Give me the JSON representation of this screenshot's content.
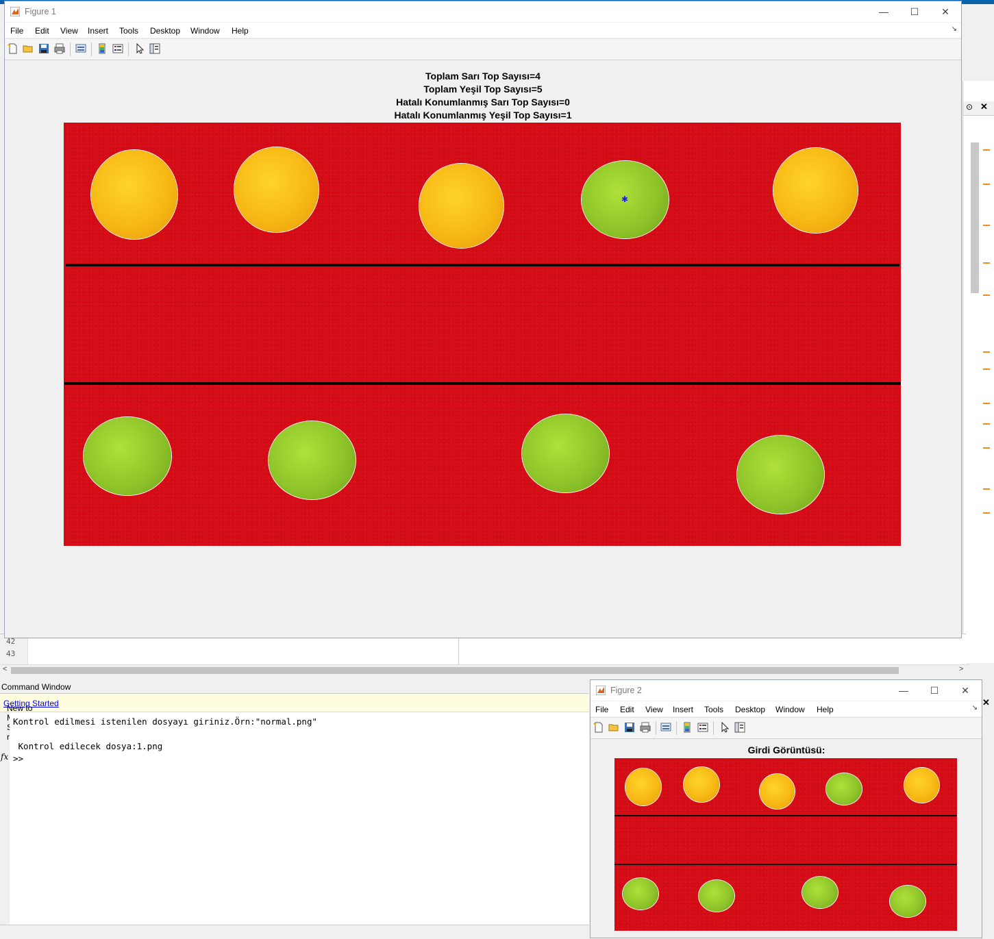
{
  "figure1": {
    "window_title": "Figure 1",
    "menu": [
      "File",
      "Edit",
      "View",
      "Insert",
      "Tools",
      "Desktop",
      "Window",
      "Help"
    ],
    "title_lines": [
      "Toplam Sarı Top Sayısı=4",
      "Toplam Yeşil Top Sayısı=5",
      "Hatalı Konumlanmış Sarı Top Sayısı=0",
      "Hatalı Konumlanmış Yeşil Top Sayısı=1"
    ],
    "ball_colors": {
      "yellow": "#f7b814",
      "green": "#8fc52a"
    },
    "court_color": "#d60d17",
    "flagged_ball": "green ball in top row marked with blue asterisk"
  },
  "figure2": {
    "window_title": "Figure 2",
    "menu": [
      "File",
      "Edit",
      "View",
      "Insert",
      "Tools",
      "Desktop",
      "Window",
      "Help"
    ],
    "title": "Girdi Görüntüsü:"
  },
  "editor": {
    "line_numbers": [
      "42",
      "43"
    ]
  },
  "command_window": {
    "title": "Command Window",
    "banner_text": "New to MATLAB? See resources for ",
    "banner_link": "Getting Started",
    "banner_suffix": ".",
    "lines": [
      "Kontrol edilmesi istenilen dosyayı giriniz.Örn:\"normal.png\"",
      "",
      " Kontrol edilecek dosya:1.png"
    ],
    "prompt_icon": "fx",
    "prompt": ">>"
  }
}
